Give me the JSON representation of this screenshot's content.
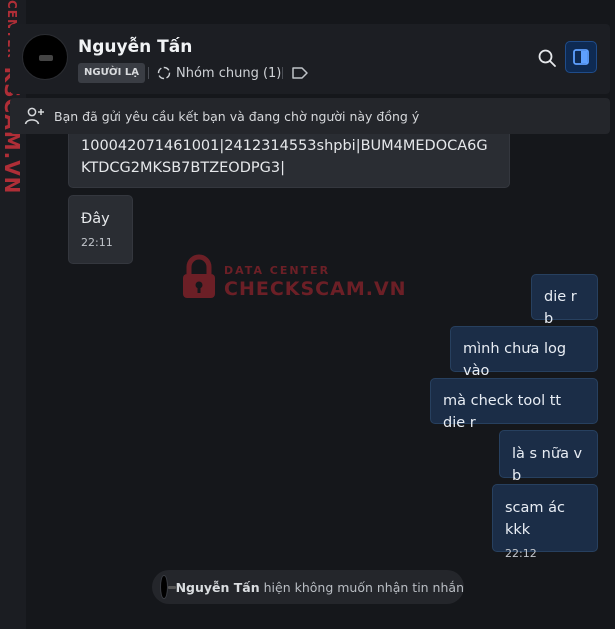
{
  "watermark": {
    "vertical_small": "CENTER",
    "vertical_big": "KSCAM.VN",
    "center_small": "DATA CENTER",
    "center_big": "CHECKSCAM.VN"
  },
  "header": {
    "name": "Nguyễn Tấn",
    "badge": "NGƯỜI LẠ",
    "group": "Nhóm chung (1)",
    "icons": [
      "group-icon",
      "tag-icon",
      "search-icon",
      "side-panel-icon"
    ],
    "accent": "#1f4c8a"
  },
  "notice": {
    "text": "Bạn đã gửi yêu cầu kết bạn và đang chờ người này đồng ý"
  },
  "messages": {
    "partial": "100042071461001|2412314553shpbi|BUM4MEDOCA6GKTDCG2MKSB7BTZEODPG3|",
    "in1": {
      "text": "Đây",
      "time": "22:11"
    },
    "out": [
      {
        "text": "die r b"
      },
      {
        "text": "mình chưa log vào"
      },
      {
        "text": "mà check tool tt die r"
      },
      {
        "text": "là s nữa v b"
      },
      {
        "text": "scam ác kkk",
        "time": "22:12"
      }
    ]
  },
  "footer": {
    "name": "Nguyễn Tấn",
    "text": "hiện không muốn nhận tin nhắn"
  }
}
